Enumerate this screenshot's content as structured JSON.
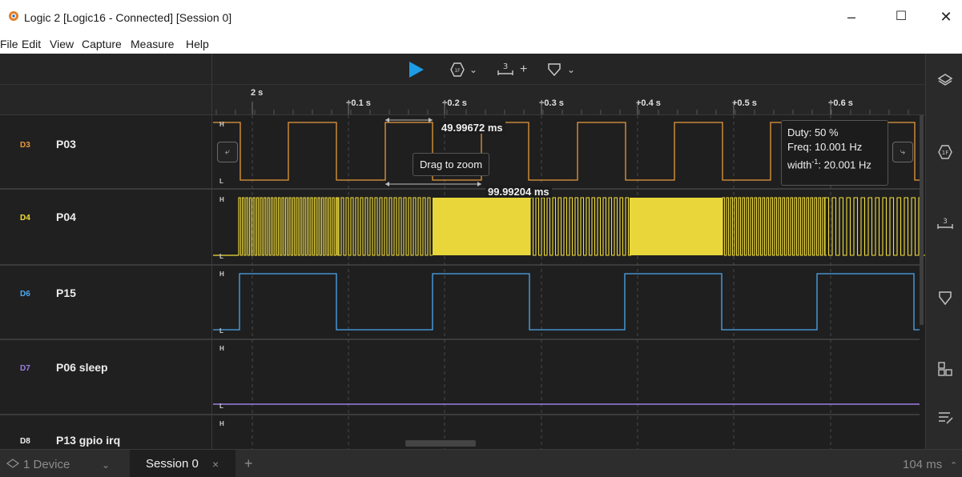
{
  "window": {
    "title": "Logic 2 [Logic16 - Connected] [Session 0]",
    "minimize": "–",
    "maximize": "☐",
    "close": "✕"
  },
  "menu": [
    "File",
    "Edit",
    "View",
    "Capture",
    "Measure",
    "Help"
  ],
  "toolbar": {
    "play_icon": "play-icon",
    "analyzer_icon": "analyzer-icon",
    "measure_label": "3",
    "measure_plus": "+",
    "marker_icon": "marker-icon",
    "chevron": "⌄"
  },
  "ruler": {
    "start": "2 s",
    "ticks": [
      "+0.1 s",
      "+0.2 s",
      "+0.3 s",
      "+0.4 s",
      "+0.5 s",
      "+0.6 s"
    ]
  },
  "channels": [
    {
      "num": "D3",
      "name": "P03",
      "color": "#e69a3a"
    },
    {
      "num": "D4",
      "name": "P04",
      "color": "#f3de3a"
    },
    {
      "num": "D6",
      "name": "P15",
      "color": "#4ca8ee"
    },
    {
      "num": "D7",
      "name": "P06 sleep",
      "color": "#9b7fe2"
    },
    {
      "num": "D8",
      "name": "P13 gpio irq",
      "color": "#f0f0f0"
    }
  ],
  "levels": {
    "high": "H",
    "low": "L"
  },
  "measurements": {
    "width1": "49.99672 ms",
    "width2": "99.99204 ms",
    "drag_hint": "Drag to zoom"
  },
  "tooltip": {
    "duty": "Duty: 50 %",
    "freq": "Freq: 10.001 Hz",
    "width_prefix": "width",
    "width_sup": "-1",
    "width_value": ": 20.001 Hz"
  },
  "sidebar_icons": [
    "layers-icon",
    "analyzers-icon",
    "measurements-icon",
    "markers-icon",
    "extensions-icon",
    "notes-icon"
  ],
  "bottom": {
    "device": "1 Device",
    "session_tab": "Session 0",
    "close_tab": "×",
    "add_tab": "+",
    "duration": "104 ms"
  }
}
